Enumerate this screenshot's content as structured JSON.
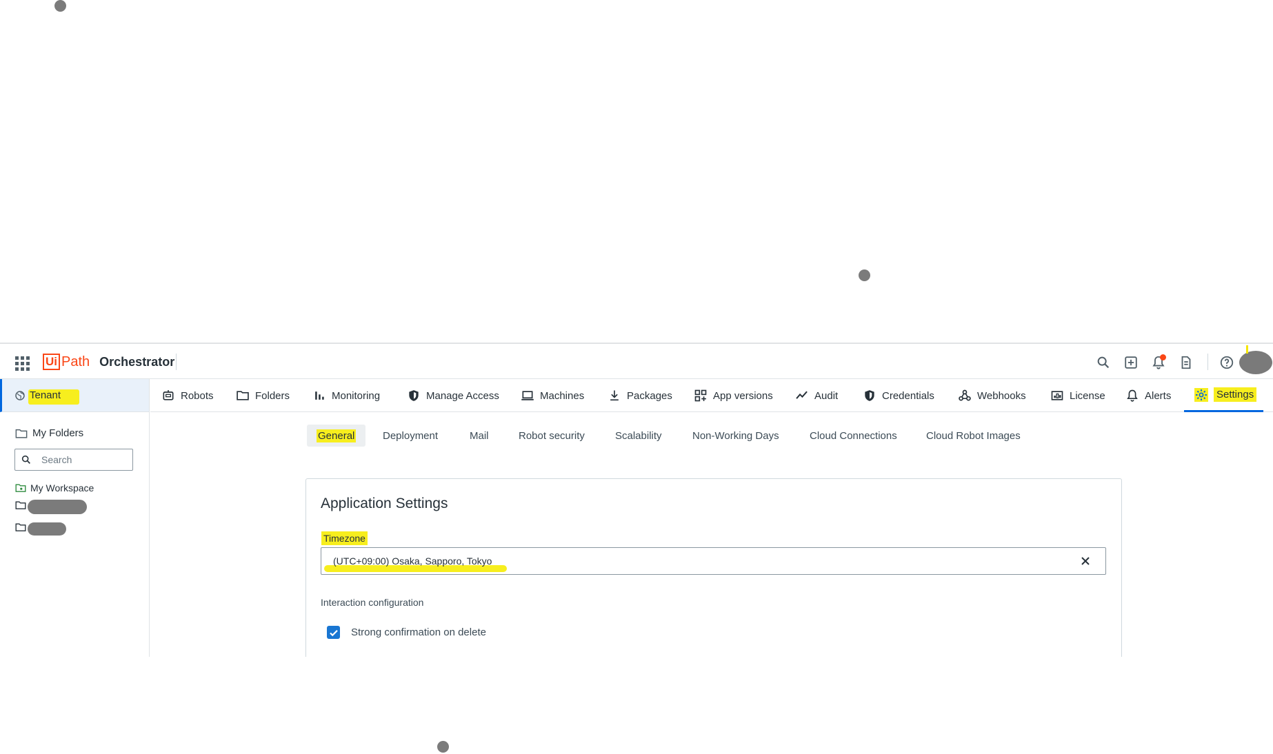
{
  "colors": {
    "accent": "#0067df",
    "brand": "#fa4616",
    "highlight": "#f7ee1e",
    "checkbox": "#1976d2"
  },
  "header": {
    "brand_ui": "Ui",
    "brand_path": "Path",
    "product": "Orchestrator",
    "icons": [
      "apps-grid-icon",
      "search-icon",
      "add-icon",
      "bell-icon",
      "document-icon",
      "help-icon"
    ]
  },
  "sidebar": {
    "tenant_label": "Tenant",
    "my_folders_label": "My Folders",
    "search_placeholder": "Search",
    "tree": [
      {
        "label": "My Workspace"
      }
    ]
  },
  "nav": {
    "items": [
      {
        "label": "Robots",
        "icon": "robot-icon"
      },
      {
        "label": "Folders",
        "icon": "folder-icon"
      },
      {
        "label": "Monitoring",
        "icon": "bar-chart-icon"
      },
      {
        "label": "Manage Access",
        "icon": "shield-icon"
      },
      {
        "label": "Machines",
        "icon": "laptop-icon"
      },
      {
        "label": "Packages",
        "icon": "download-icon"
      },
      {
        "label": "App versions",
        "icon": "apps-icon"
      },
      {
        "label": "Audit",
        "icon": "trend-icon"
      },
      {
        "label": "Credentials",
        "icon": "shield-icon"
      },
      {
        "label": "Webhooks",
        "icon": "webhook-icon"
      },
      {
        "label": "License",
        "icon": "license-icon"
      },
      {
        "label": "Alerts",
        "icon": "bell-icon"
      },
      {
        "label": "Settings",
        "icon": "gear-icon",
        "active": true
      }
    ]
  },
  "subtabs": {
    "items": [
      {
        "label": "General",
        "active": true
      },
      {
        "label": "Deployment"
      },
      {
        "label": "Mail"
      },
      {
        "label": "Robot security"
      },
      {
        "label": "Scalability"
      },
      {
        "label": "Non-Working Days"
      },
      {
        "label": "Cloud Connections"
      },
      {
        "label": "Cloud Robot Images"
      }
    ]
  },
  "card": {
    "title": "Application Settings",
    "timezone_label": "Timezone",
    "timezone_value": "(UTC+09:00) Osaka, Sapporo, Tokyo",
    "interaction_label": "Interaction configuration",
    "strong_confirm_label": "Strong confirmation on delete",
    "strong_confirm_checked": true
  }
}
